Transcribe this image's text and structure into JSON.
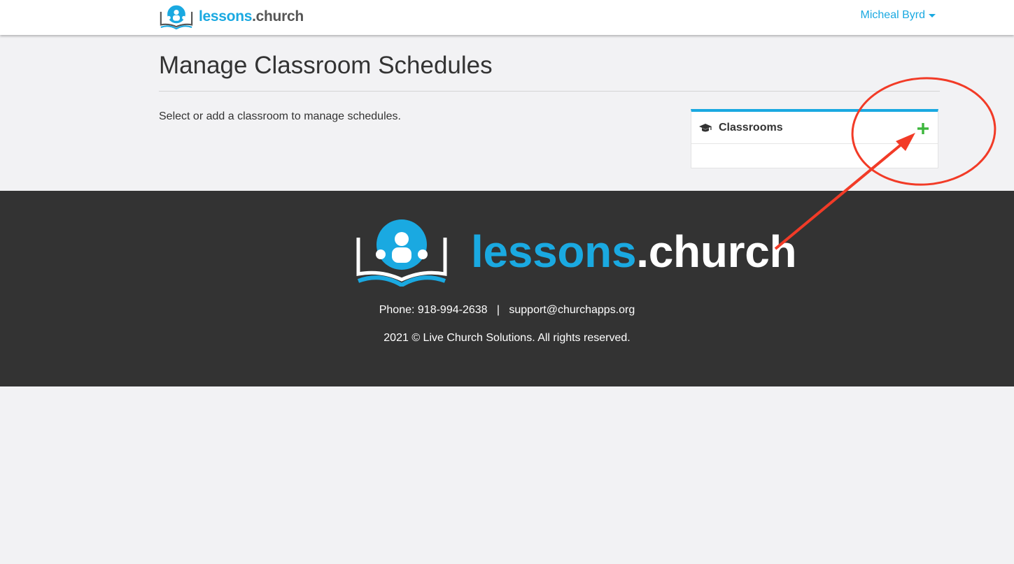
{
  "header": {
    "brand_part1": "lessons",
    "brand_part2": ".church",
    "user_name": "Micheal Byrd"
  },
  "main": {
    "title": "Manage Classroom Schedules",
    "intro": "Select or add a classroom to manage schedules."
  },
  "classrooms_panel": {
    "title": "Classrooms",
    "icon": "graduation-cap-icon",
    "add_icon": "plus-icon",
    "items": []
  },
  "footer": {
    "brand_part1": "lessons",
    "brand_part2": ".church",
    "phone_label": "Phone:",
    "phone": "918-994-2638",
    "separator": "|",
    "email": "support@churchapps.org",
    "copyright": "2021 © Live Church Solutions. All rights reserved."
  },
  "colors": {
    "brand_blue": "#1aa9e1",
    "add_green": "#3cb63c",
    "footer_bg": "#333333",
    "annotation_red": "#f23b27"
  }
}
